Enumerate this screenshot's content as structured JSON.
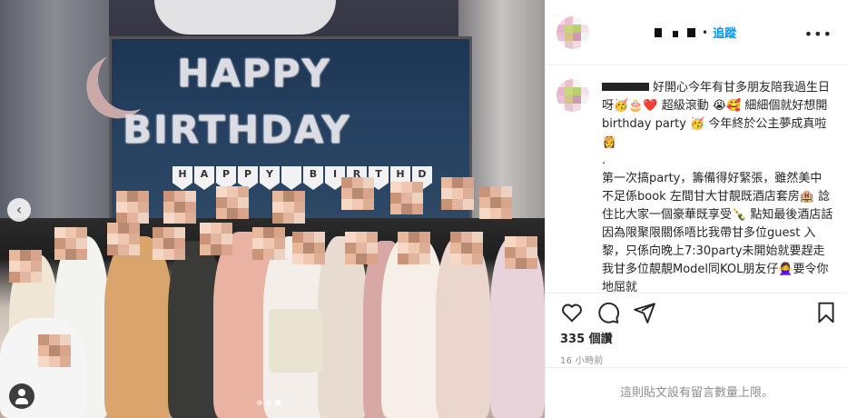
{
  "post": {
    "photo_alt": "",
    "balloons_line1": "HAPPY",
    "balloons_line2": "BIRTHDAY",
    "banner_letters": [
      "H",
      "A",
      "P",
      "P",
      "Y",
      " ",
      "B",
      "I",
      "R",
      "T",
      "H",
      "D"
    ],
    "carousel_index": 3,
    "carousel_count": 3
  },
  "header": {
    "username": "",
    "follow_label": "追蹤",
    "more_icon": "more-horizontal-icon"
  },
  "caption": {
    "text": "好開心今年有甘多朋友陪我過生日呀🥳🎂❤️ 超級滾動 😭🥰 細細個就好想開birthday party 🥳 今年終於公主夢成真啦👸\n.\n第一次搞party，籌備得好緊張，雖然美中不足係book 左間甘大甘靚既酒店套房🏨 諗住比大家一個豪華既享受🍾 點知最後酒店話因為限聚限關係唔比我帶甘多位guest 入黎，只係向晚上7:30party未開始就要趕走我甘多位靚靚Model同KOL朋友仔🙅‍♀️要令你地屈就"
  },
  "actions": {
    "like_icon": "heart-icon",
    "comment_icon": "comment-icon",
    "share_icon": "share-icon",
    "save_icon": "bookmark-icon"
  },
  "stats": {
    "likes": "335 個讚",
    "time_ago": "16 小時前"
  },
  "footer": {
    "comments_limited": "這則貼文設有留言數量上限。"
  }
}
